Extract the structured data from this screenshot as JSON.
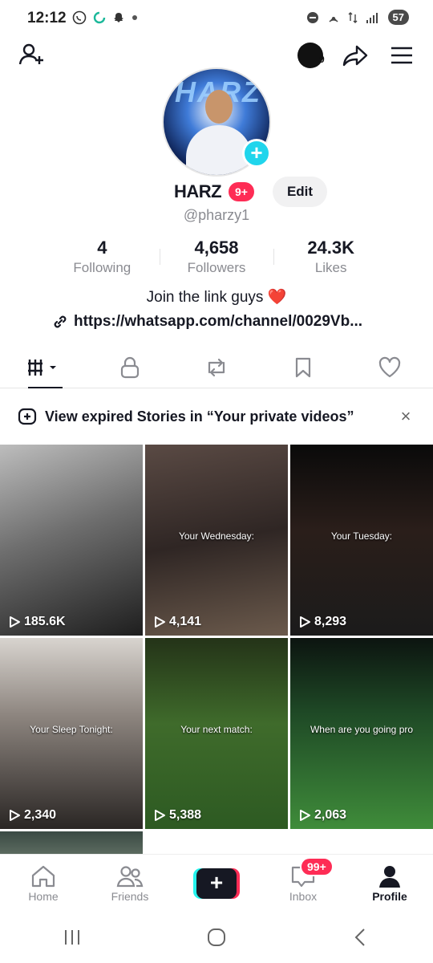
{
  "status_bar": {
    "time": "12:12",
    "battery": "57"
  },
  "header": {
    "notification_count": "9"
  },
  "profile": {
    "username": "HARZ",
    "name_badge": "9+",
    "edit_label": "Edit",
    "handle": "@pharzy1",
    "stats": [
      {
        "value": "4",
        "label": "Following"
      },
      {
        "value": "4,658",
        "label": "Followers"
      },
      {
        "value": "24.3K",
        "label": "Likes"
      }
    ],
    "bio": "Join the link guys",
    "bio_emoji": "❤️",
    "link": "https://whatsapp.com/channel/0029Vb..."
  },
  "tabs": [
    "videos-grid-icon",
    "lock-icon",
    "repost-icon",
    "bookmark-icon",
    "heart-icon"
  ],
  "banner": {
    "text": "View expired Stories in “Your private videos”"
  },
  "videos": [
    {
      "caption": "",
      "views": "185.6K"
    },
    {
      "caption": "Your Wednesday:",
      "views": "4,141"
    },
    {
      "caption": "Your Tuesday:",
      "views": "8,293"
    },
    {
      "caption": "Your Sleep Tonight:",
      "views": "2,340"
    },
    {
      "caption": "Your next match:",
      "views": "5,388"
    },
    {
      "caption": "When are you going pro",
      "views": "2,063"
    }
  ],
  "bottom_nav": {
    "home": "Home",
    "friends": "Friends",
    "inbox": "Inbox",
    "inbox_badge": "99+",
    "profile": "Profile"
  },
  "colors": {
    "accent": "#fe2c55",
    "cyan": "#25f4ee",
    "plus_badge": "#20d5ec"
  }
}
